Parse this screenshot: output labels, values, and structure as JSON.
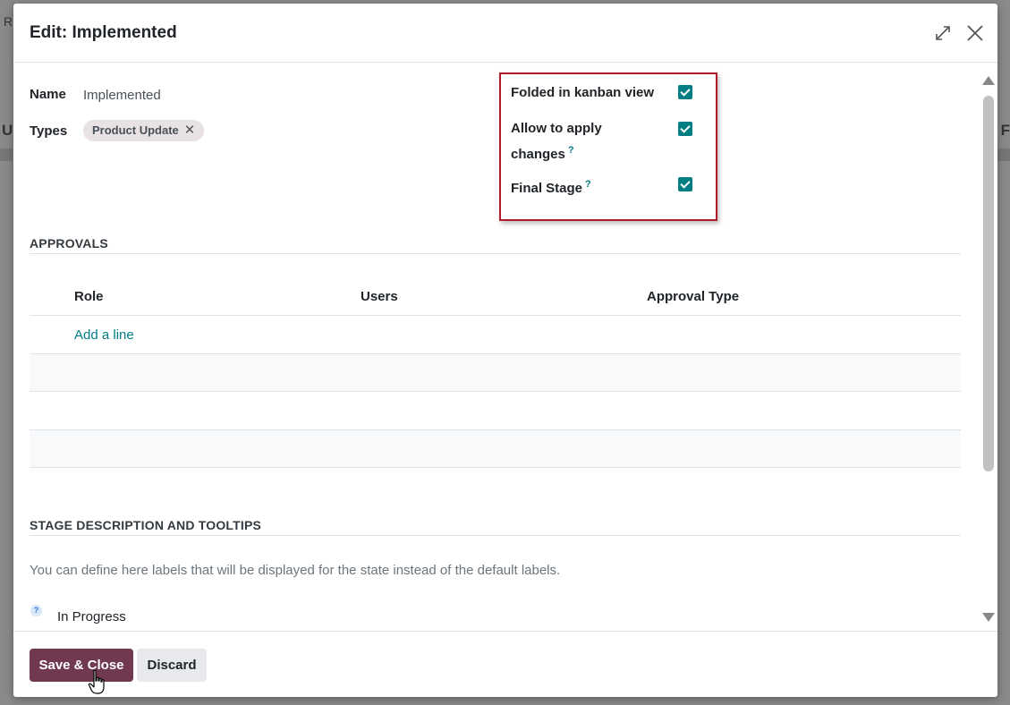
{
  "background": {
    "frag_left_top": "R",
    "frag_left_mid": "U",
    "frag_right_mid": "F"
  },
  "modal": {
    "title": "Edit: Implemented",
    "expand_icon": "expand-icon",
    "close_icon": "close-icon"
  },
  "form": {
    "name_label": "Name",
    "name_value": "Implemented",
    "types_label": "Types",
    "types_tags": [
      "Product Update"
    ],
    "tag_remove_glyph": "✕"
  },
  "options": {
    "folded": {
      "label": "Folded in kanban view",
      "checked": true
    },
    "allow_changes": {
      "label_line1": "Allow to apply",
      "label_line2": "changes",
      "help": "?",
      "checked": true
    },
    "final_stage": {
      "label": "Final Stage",
      "help": "?",
      "checked": true
    }
  },
  "approvals": {
    "title": "APPROVALS",
    "columns": [
      "Role",
      "Users",
      "Approval Type"
    ],
    "add_line": "Add a line"
  },
  "stage_description": {
    "title": "STAGE DESCRIPTION AND TOOLTIPS",
    "text": "You can define here labels that will be displayed for the state instead of the default labels.",
    "help": "?",
    "in_progress": "In Progress"
  },
  "footer": {
    "save_label": "Save & Close",
    "discard_label": "Discard"
  },
  "colors": {
    "primary": "#71394f",
    "accent": "#017e84",
    "highlight": "#b01c25"
  }
}
